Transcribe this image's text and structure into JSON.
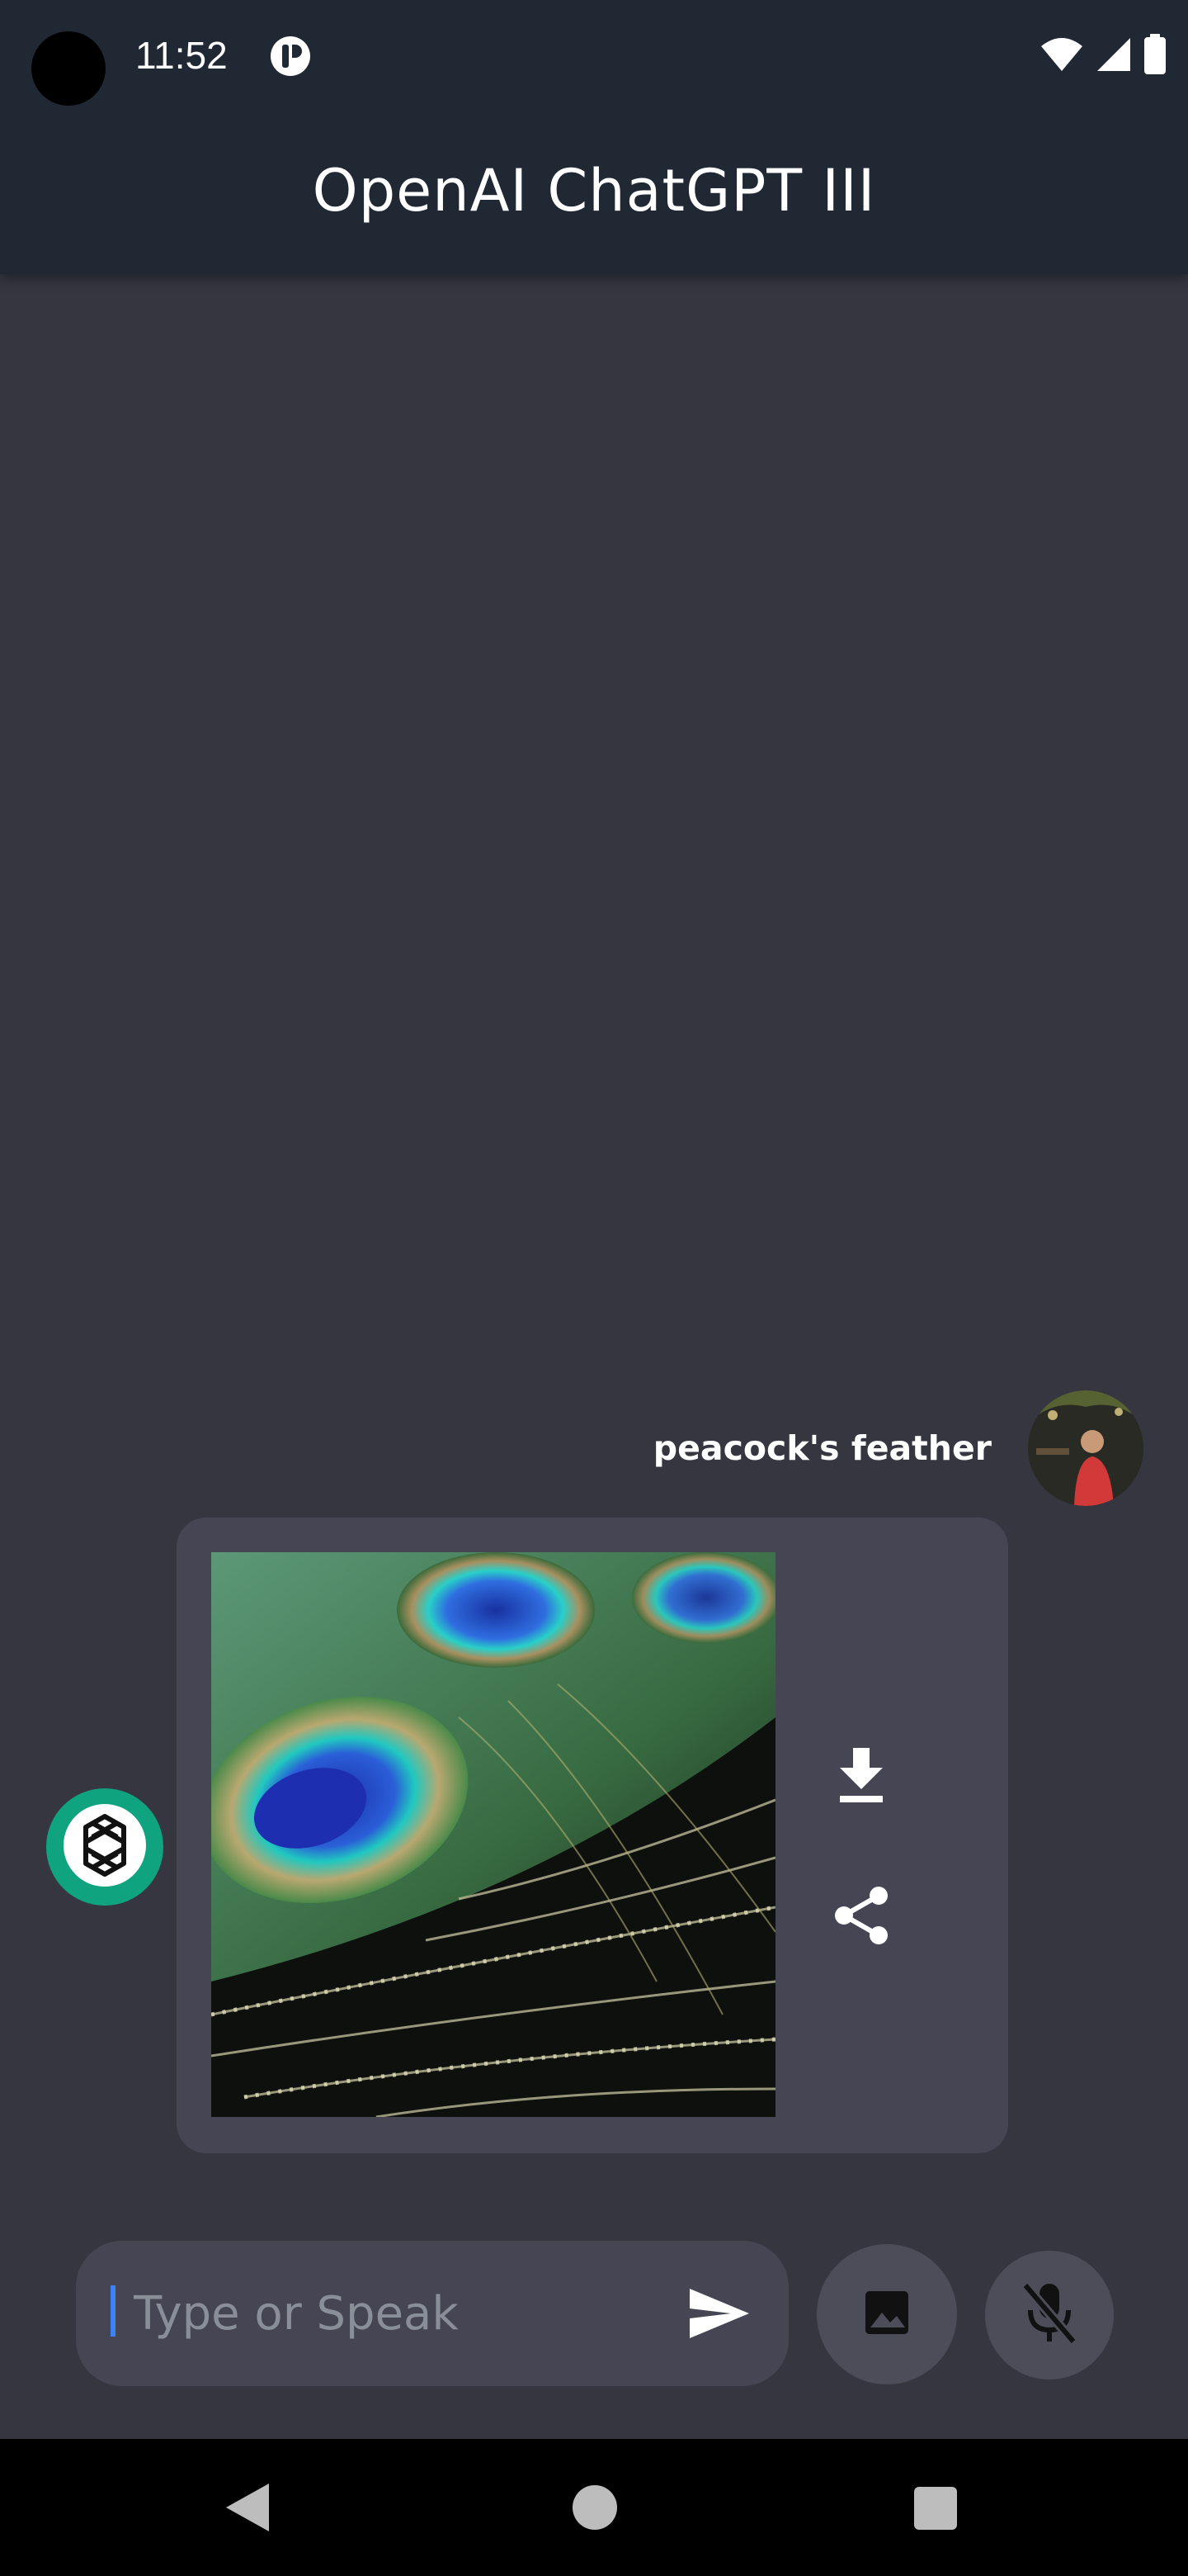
{
  "status_bar": {
    "time": "11:52"
  },
  "app_bar": {
    "title": "OpenAI  ChatGPT III"
  },
  "chat": {
    "user_message": "peacock's feather"
  },
  "input": {
    "placeholder": "Type or Speak",
    "value": ""
  },
  "colors": {
    "background": "#363641",
    "app_bar": "#202834",
    "card": "#454554",
    "bot_avatar": "#10a37f",
    "caret": "#3b82f6"
  },
  "icons": {
    "download": "download-icon",
    "share": "share-icon",
    "send": "send-icon",
    "image": "image-icon",
    "mic_off": "mic-off-icon",
    "bot": "openai-logo-icon"
  }
}
